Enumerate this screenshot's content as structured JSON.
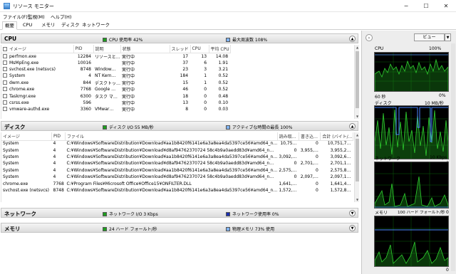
{
  "window": {
    "title": "リソース モニター",
    "minimize": "─",
    "maximize": "☐",
    "close": "✕"
  },
  "menu": [
    {
      "label": "ファイル(F)"
    },
    {
      "label": "監視(M)"
    },
    {
      "label": "ヘルプ(H)"
    }
  ],
  "tabs": [
    {
      "label": "概要"
    },
    {
      "label": "CPU"
    },
    {
      "label": "メモリ"
    },
    {
      "label": "ディスク"
    },
    {
      "label": "ネットワーク"
    }
  ],
  "colors": {
    "green": "#1e9e1e",
    "blue": "#2b6fd6",
    "graph_bg": "#000000",
    "graph_grid": "#0b5e0b"
  },
  "cpu": {
    "title": "CPU",
    "legend1": "CPU 使用率 42%",
    "legend2": "最大周波数 108%",
    "columns": [
      "イメージ",
      "PID",
      "説明",
      "状態",
      "スレッド",
      "CPU",
      "平均 CPU"
    ],
    "rows": [
      [
        "perfmon.exe",
        "12284",
        "リソースと…",
        "実行中",
        "17",
        "13",
        "14.08"
      ],
      [
        "MsMpEng.exe",
        "10016",
        "",
        "実行中",
        "37",
        "6",
        "1.91"
      ],
      [
        "svchost.exe (netsvcs)",
        "8748",
        "Window…",
        "実行中",
        "23",
        "3",
        "3.21"
      ],
      [
        "System",
        "4",
        "NT Kern…",
        "実行中",
        "184",
        "1",
        "0.52"
      ],
      [
        "dwm.exe",
        "844",
        "デスクトッ…",
        "実行中",
        "15",
        "1",
        "0.52"
      ],
      [
        "chrome.exe",
        "7768",
        "Google …",
        "実行中",
        "46",
        "0",
        "0.52"
      ],
      [
        "Taskmgr.exe",
        "6300",
        "タスク マ…",
        "実行中",
        "18",
        "0",
        "0.48"
      ],
      [
        "csrss.exe",
        "596",
        "",
        "実行中",
        "13",
        "0",
        "0.10"
      ],
      [
        "vmware-authd.exe",
        "3360",
        "VMwar…",
        "実行中",
        "8",
        "0",
        "0.03"
      ]
    ]
  },
  "disk": {
    "title": "ディスク",
    "legend1": "ディスク I/O 55 MB/秒",
    "legend2": "アクティブな時間の最長 100%",
    "columns": [
      "イメージ",
      "PID",
      "ファイル",
      "読み取…",
      "書き込…",
      "合計 (バイト/…"
    ],
    "rows": [
      [
        "System",
        "4",
        "C:¥Windows¥SoftwareDistribution¥Download¥aa1b8420f6141e6a3a8ea4da5397ce56¥amd64_n…",
        "10,75…",
        "0",
        "10,751,7…"
      ],
      [
        "System",
        "4",
        "C:¥Windows¥SoftwareDistribution¥Download¥d8af94762370724 58c4b9a0aedd83d¥amd64_n…",
        "0",
        "3,955,…",
        "3,955,2…"
      ],
      [
        "System",
        "4",
        "C:¥Windows¥SoftwareDistribution¥Download¥aa1b8420f6141e6a3a8ea4da5397ce56¥amd64_n…",
        "3,092,…",
        "0",
        "3,092,6…"
      ],
      [
        "System",
        "4",
        "C:¥Windows¥SoftwareDistribution¥Download¥d8af94762370724 58c4b9a0aedd83d¥amd64_n…",
        "0",
        "2,701,…",
        "2,701,1…"
      ],
      [
        "System",
        "4",
        "C:¥Windows¥SoftwareDistribution¥Download¥aa1b8420f6141e6a3a8ea4da5397ce56¥amd64_n…",
        "2,575,…",
        "0",
        "2,575,8…"
      ],
      [
        "System",
        "4",
        "C:¥Windows¥SoftwareDistribution¥Download¥d8af94762370724 58c4b9a0aedd83d¥amd64_n…",
        "0",
        "2,097,…",
        "2,097,1…"
      ],
      [
        "chrome.exe",
        "7768",
        "C:¥Program Files¥Microsoft Office¥Office15¥ONFILTER.DLL",
        "1,641,…",
        "0",
        "1,641,4…"
      ],
      [
        "svchost.exe (netsvcs)",
        "8748",
        "C:¥Windows¥SoftwareDistribution¥Download¥aa1b8420f6141e6a3a8ea4da5397ce56¥amd64_n…",
        "1,572,…",
        "0",
        "1,572,8…"
      ]
    ]
  },
  "network": {
    "title": "ネットワーク",
    "legend1": "ネットワーク I/O 3 Kbps",
    "legend2": "ネットワーク使用率 0%"
  },
  "memory": {
    "title": "メモリ",
    "legend1": "24 ハード フォールト/秒",
    "legend2": "物理メモリ 73% 使用"
  },
  "right_pane": {
    "view_label": "ビュー",
    "nav_icon": "chevron-right-icon",
    "graphs": [
      {
        "name": "CPU",
        "top_right": "100%",
        "bottom_left": "60 秒",
        "bottom_right": "0%"
      },
      {
        "name": "ディスク",
        "top_right": "10 MB/秒",
        "bottom_left": "",
        "bottom_right": "0"
      },
      {
        "name": "ネットワーク",
        "top_right": "10 Kbps",
        "bottom_left": "",
        "bottom_right": "0"
      },
      {
        "name": "メモリ",
        "top_right": "100 ハード フォールト/秒",
        "bottom_left": "",
        "bottom_right": "0"
      }
    ]
  }
}
